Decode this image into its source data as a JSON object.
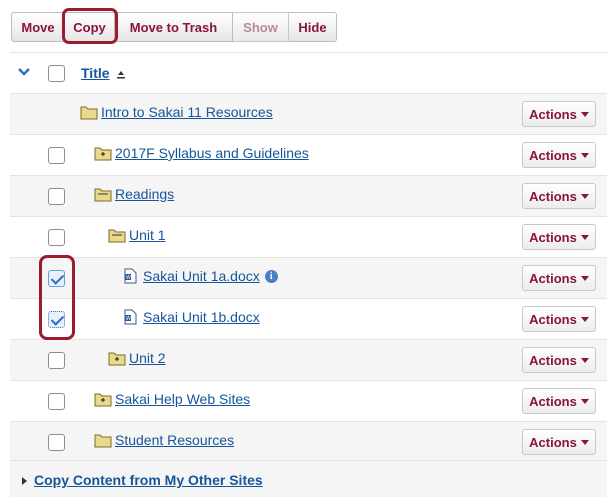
{
  "toolbar": {
    "move": "Move",
    "copy": "Copy",
    "trash": "Move to Trash",
    "show": "Show",
    "hide": "Hide"
  },
  "header": {
    "title": "Title"
  },
  "rows": [
    {
      "label": "Intro to Sakai 11 Resources",
      "type": "folder",
      "checkbox": false,
      "checked": false,
      "actions": "Actions"
    },
    {
      "label": "2017F Syllabus and Guidelines",
      "type": "folder-plus",
      "checkbox": true,
      "checked": false,
      "actions": "Actions"
    },
    {
      "label": "Readings",
      "type": "folder-open",
      "checkbox": true,
      "checked": false,
      "actions": "Actions"
    },
    {
      "label": "Unit 1",
      "type": "folder-open",
      "checkbox": true,
      "checked": false,
      "actions": "Actions"
    },
    {
      "label": "Sakai Unit 1a.docx",
      "type": "docx",
      "checkbox": true,
      "checked": true,
      "info": true,
      "actions": "Actions"
    },
    {
      "label": "Sakai Unit 1b.docx",
      "type": "docx",
      "checkbox": true,
      "checked": true,
      "actions": "Actions"
    },
    {
      "label": "Unit 2",
      "type": "folder-plus",
      "checkbox": true,
      "checked": false,
      "actions": "Actions"
    },
    {
      "label": "Sakai Help Web Sites",
      "type": "folder-plus",
      "checkbox": true,
      "checked": false,
      "actions": "Actions"
    },
    {
      "label": "Student Resources",
      "type": "folder",
      "checkbox": true,
      "checked": false,
      "actions": "Actions"
    }
  ],
  "footer": {
    "label": "Copy Content from My Other Sites"
  },
  "colors": {
    "link": "#15559a",
    "button_text": "#8a1538",
    "highlight": "#9b1b2f",
    "folder": "#e9d98a"
  }
}
